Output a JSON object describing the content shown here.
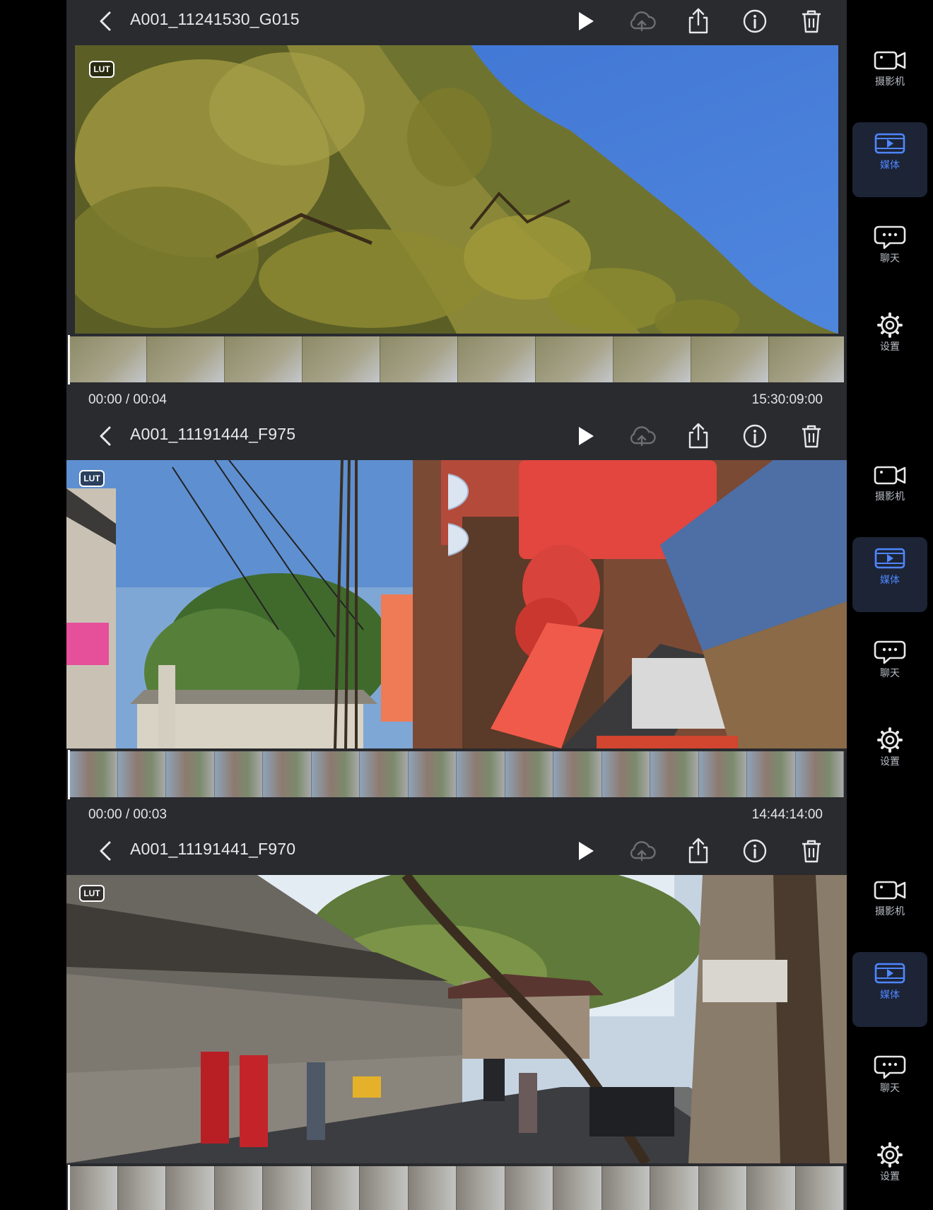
{
  "clips": [
    {
      "filename": "A001_11241530_G015",
      "badge": "LUT",
      "time_position": "00:00 / 00:04",
      "timecode": "15:30:09:00",
      "scene": "tree",
      "thumbnail_count": 10
    },
    {
      "filename": "A001_11191444_F975",
      "badge": "LUT",
      "time_position": "00:00 / 00:03",
      "timecode": "14:44:14:00",
      "scene": "street",
      "thumbnail_count": 16
    },
    {
      "filename": "A001_11191441_F970",
      "badge": "LUT",
      "time_position": "",
      "timecode": "",
      "scene": "alley",
      "thumbnail_count": 16
    }
  ],
  "sidebar": {
    "items": [
      {
        "label": "摄影机",
        "icon": "camera-icon",
        "active": false
      },
      {
        "label": "媒体",
        "icon": "media-icon",
        "active": true
      },
      {
        "label": "聊天",
        "icon": "chat-icon",
        "active": false
      },
      {
        "label": "设置",
        "icon": "gear-icon",
        "active": false
      }
    ]
  },
  "toolbar": {
    "icons": [
      "back-icon",
      "play-icon",
      "cloud-upload-icon",
      "share-icon",
      "info-icon",
      "trash-icon"
    ]
  },
  "colors": {
    "panel_bg": "#2a2b2f",
    "sidebar_bg": "#000000",
    "active_tab_bg": "#1c2436",
    "accent": "#4f86ff",
    "cloud_disabled": "#6e6f74"
  }
}
